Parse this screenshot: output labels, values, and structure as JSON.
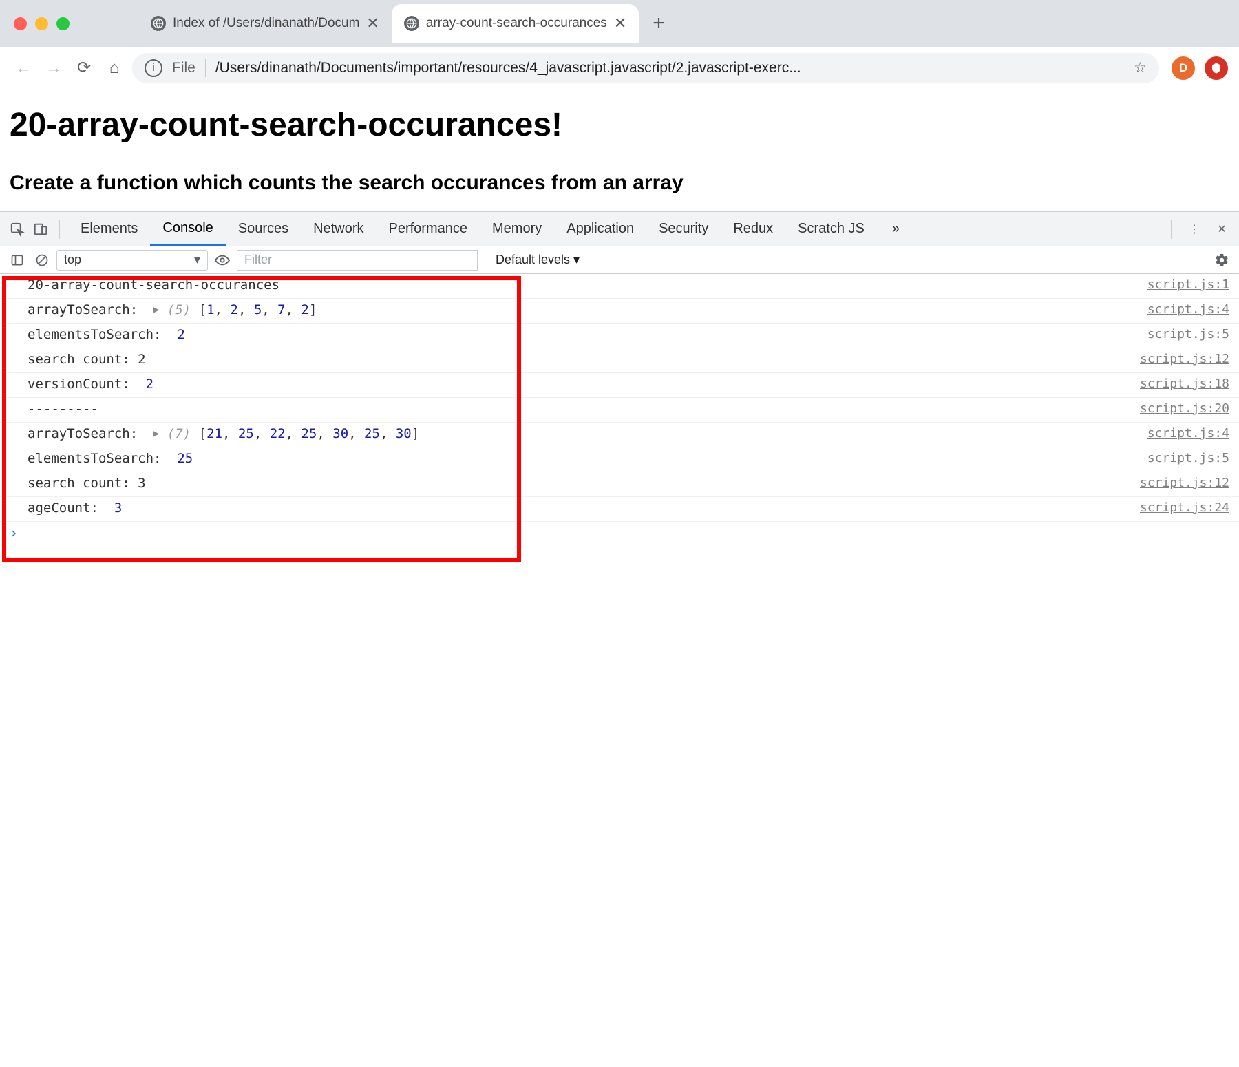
{
  "browser": {
    "tabs": [
      {
        "title": "Index of /Users/dinanath/Docum"
      },
      {
        "title": "array-count-search-occurances"
      }
    ],
    "new_tab_tooltip": "+",
    "address": {
      "scheme": "File",
      "path": "/Users/dinanath/Documents/important/resources/4_javascript.javascript/2.javascript-exerc..."
    },
    "avatar_letter": "D"
  },
  "page": {
    "h1": "20-array-count-search-occurances!",
    "h2": "Create a function which counts the search occurances from an array"
  },
  "devtools": {
    "panels": [
      "Elements",
      "Console",
      "Sources",
      "Network",
      "Performance",
      "Memory",
      "Application",
      "Security",
      "Redux",
      "Scratch JS"
    ],
    "active_panel": "Console",
    "more_label": "»",
    "filterbar": {
      "context": "top",
      "filter_placeholder": "Filter",
      "levels": "Default levels ▾"
    },
    "console": {
      "rows": [
        {
          "msg_html": "20-array-count-search-occurances",
          "src": "script.js:1"
        },
        {
          "msg_html": "arrayToSearch:  <span class='tri'>▶</span> <span class='meta'>(5)</span> [<span class='num'>1</span>, <span class='num'>2</span>, <span class='num'>5</span>, <span class='num'>7</span>, <span class='num'>2</span>]",
          "src": "script.js:4"
        },
        {
          "msg_html": "elementsToSearch:  <span class='num'>2</span>",
          "src": "script.js:5"
        },
        {
          "msg_html": "search count: 2",
          "src": "script.js:12"
        },
        {
          "msg_html": "versionCount:  <span class='num'>2</span>",
          "src": "script.js:18"
        },
        {
          "msg_html": "---------",
          "src": "script.js:20"
        },
        {
          "msg_html": "arrayToSearch:  <span class='tri'>▶</span> <span class='meta'>(7)</span> [<span class='num'>21</span>, <span class='num'>25</span>, <span class='num'>22</span>, <span class='num'>25</span>, <span class='num'>30</span>, <span class='num'>25</span>, <span class='num'>30</span>]",
          "src": "script.js:4"
        },
        {
          "msg_html": "elementsToSearch:  <span class='num'>25</span>",
          "src": "script.js:5"
        },
        {
          "msg_html": "search count: 3",
          "src": "script.js:12"
        },
        {
          "msg_html": "ageCount:  <span class='num'>3</span>",
          "src": "script.js:24"
        }
      ]
    }
  }
}
